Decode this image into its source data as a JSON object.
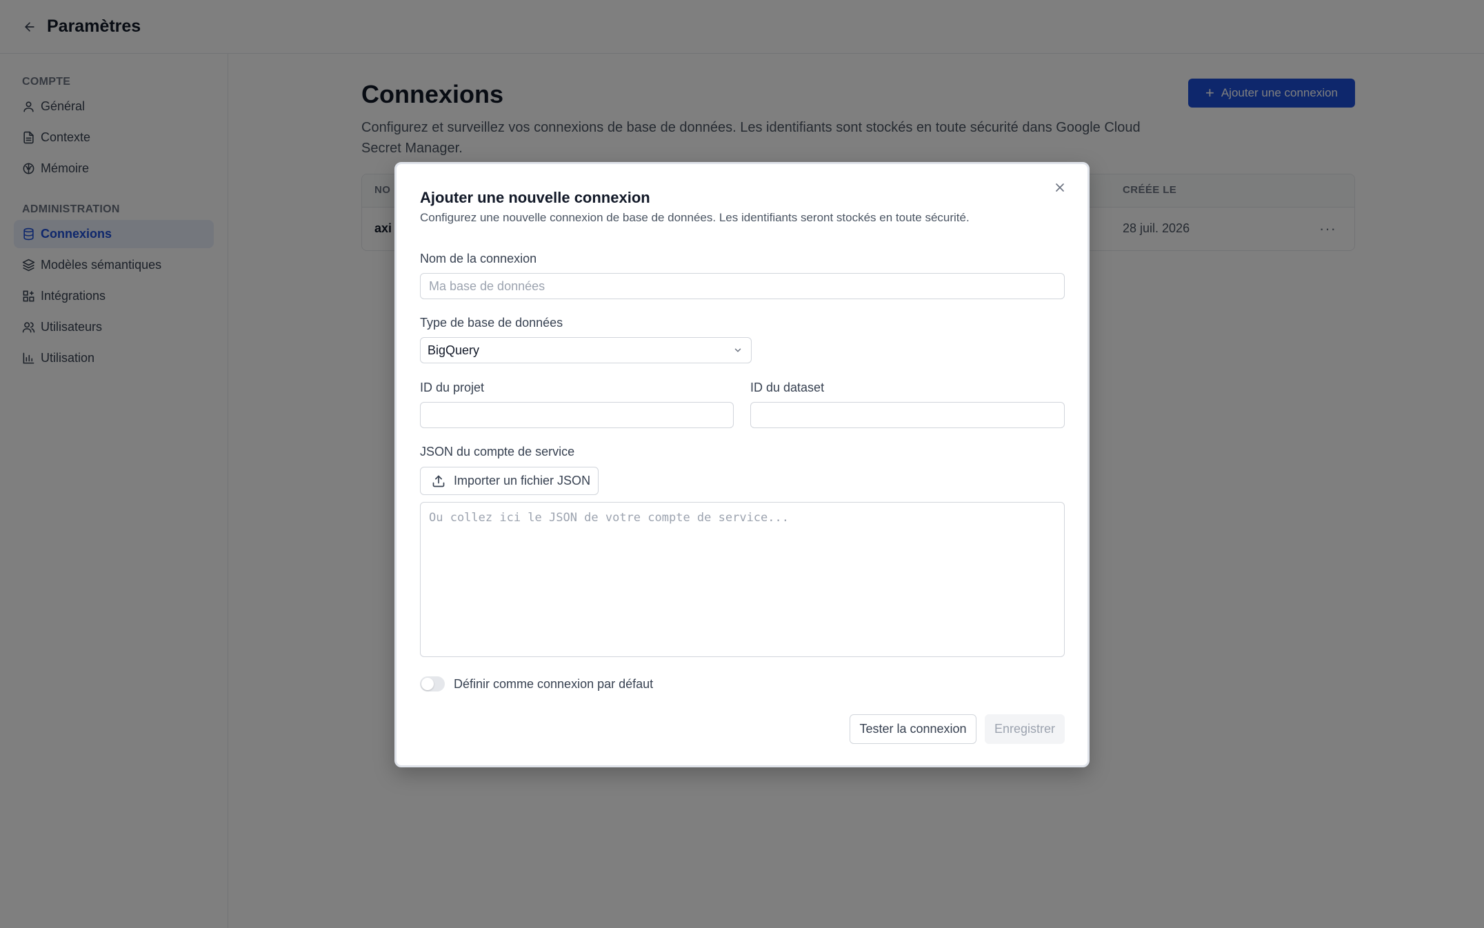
{
  "header": {
    "title": "Paramètres",
    "back_icon": "arrow-left-icon"
  },
  "sidebar": {
    "sections": [
      {
        "label": "COMPTE",
        "items": [
          {
            "label": "Général",
            "icon": "user-icon"
          },
          {
            "label": "Contexte",
            "icon": "file-text-icon"
          },
          {
            "label": "Mémoire",
            "icon": "brain-icon"
          }
        ]
      },
      {
        "label": "ADMINISTRATION",
        "items": [
          {
            "label": "Connexions",
            "icon": "database-icon",
            "active": true
          },
          {
            "label": "Modèles sémantiques",
            "icon": "layers-icon"
          },
          {
            "label": "Intégrations",
            "icon": "grid-plus-icon"
          },
          {
            "label": "Utilisateurs",
            "icon": "users-icon"
          },
          {
            "label": "Utilisation",
            "icon": "bar-chart-icon"
          }
        ]
      }
    ]
  },
  "main": {
    "title": "Connexions",
    "description": "Configurez et surveillez vos connexions de base de données. Les identifiants sont stockés en toute sécurité dans Google Cloud Secret Manager.",
    "add_button": "Ajouter une connexion",
    "table": {
      "headers": {
        "name": "NO",
        "created": "CRÉÉE LE"
      },
      "rows": [
        {
          "name": "axi",
          "created": "28 juil. 2026",
          "menu": "···"
        }
      ]
    }
  },
  "modal": {
    "title": "Ajouter une nouvelle connexion",
    "description": "Configurez une nouvelle connexion de base de données. Les identifiants seront stockés en toute sécurité.",
    "name_label": "Nom de la connexion",
    "name_placeholder": "Ma base de données",
    "db_type_label": "Type de base de données",
    "db_type_value": "BigQuery",
    "project_label": "ID du projet",
    "dataset_label": "ID du dataset",
    "json_label": "JSON du compte de service",
    "import_button": "Importer un fichier JSON",
    "json_placeholder": "Ou collez ici le JSON de votre compte de service...",
    "default_toggle_label": "Définir comme connexion par défaut",
    "default_toggle_on": false,
    "test_button": "Tester la connexion",
    "save_button": "Enregistrer"
  },
  "colors": {
    "accent": "#1d4ed8",
    "overlay": "rgba(0,0,0,0.5)"
  }
}
